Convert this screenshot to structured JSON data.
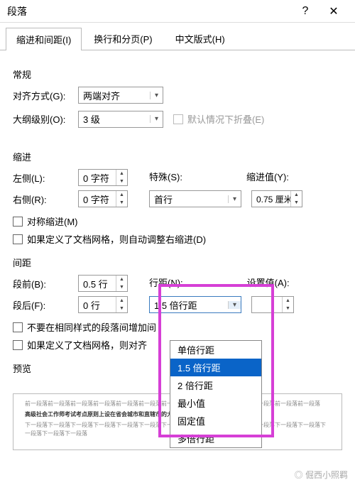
{
  "window": {
    "title": "段落",
    "help": "?",
    "close": "✕"
  },
  "tabs": {
    "t1": "缩进和间距(I)",
    "t2": "换行和分页(P)",
    "t3": "中文版式(H)"
  },
  "general": {
    "title": "常规",
    "align_label": "对齐方式(G):",
    "align_value": "两端对齐",
    "outline_label": "大纲级别(O):",
    "outline_value": "3 级",
    "collapse_label": "默认情况下折叠(E)"
  },
  "indent": {
    "title": "缩进",
    "left_label": "左侧(L):",
    "left_value": "0 字符",
    "right_label": "右侧(R):",
    "right_value": "0 字符",
    "special_label": "特殊(S):",
    "special_value": "首行",
    "indval_label": "缩进值(Y):",
    "indval_value": "0.75 厘米",
    "mirror_label": "对称缩进(M)",
    "grid_label": "如果定义了文档网格，则自动调整右缩进(D)"
  },
  "spacing": {
    "title": "间距",
    "before_label": "段前(B):",
    "before_value": "0.5 行",
    "after_label": "段后(F):",
    "after_value": "0 行",
    "line_label": "行距(N):",
    "line_value": "1.5 倍行距",
    "setval_label": "设置值(A):",
    "setval_value": "",
    "nosame_label": "不要在相同样式的段落间增加间",
    "grid_label": "如果定义了文档网格，则对齐"
  },
  "line_options": {
    "o1": "单倍行距",
    "o2": "1.5 倍行距",
    "o3": "2 倍行距",
    "o4": "最小值",
    "o5": "固定值",
    "o6": "多倍行距"
  },
  "preview": {
    "title": "预览",
    "filler": "前一段落前一段落前一段落前一段落前一段落前一段落前一段落前一段落前一段落前一段落前一段落前一段落前一段落",
    "bold": "高级社会工作师考试考点原则上设在省会城市和直辖市的大、中专院校或高考定点学校.",
    "filler2": "下一段落下一段落下一段落下一段落下一段落下一段落下一段落下一段落下一段落下一段落下一段落下一段落下一段落下一段落下一段落下一段落"
  },
  "watermark": "倔西小照羁"
}
